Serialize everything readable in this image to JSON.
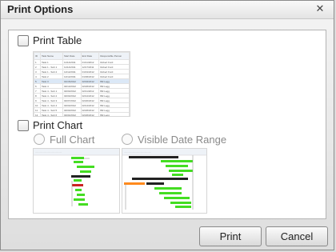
{
  "dialog": {
    "title": "Print Options",
    "close_icon": "close-icon (x)"
  },
  "print_table": {
    "label": "Print Table",
    "checked": false,
    "preview": {
      "columns": [
        "ID",
        "Task Name",
        "Start Date",
        "End Date",
        "Responsible Person"
      ],
      "rows": [
        [
          "1",
          "Task 1",
          "11/14/2011",
          "01/11/2012",
          "Robert Ford"
        ],
        [
          "2",
          "Task 1 - Sub 1",
          "11/14/2011",
          "12/17/2011",
          "Robert Ford"
        ],
        [
          "3",
          "Task 1 - Sub 2",
          "12/12/2011",
          "01/01/2012",
          "Robert Ford"
        ],
        [
          "4",
          "Task 2",
          "12/12/2011",
          "01/06/2012",
          "Robert Ford"
        ],
        [
          "5",
          "Task 3",
          "01/15/2012",
          "02/02/2012",
          "Bill Legg"
        ],
        [
          "6",
          "Task 4",
          "02/13/2012",
          "02/26/2012",
          "Bill Legg"
        ],
        [
          "7",
          "Task 4 - Sub 1",
          "02/03/2012",
          "02/11/2012",
          "Bill Legg"
        ],
        [
          "8",
          "Task 4 - Sub 2",
          "02/03/2012",
          "02/12/2012",
          "Bill Legg"
        ],
        [
          "9",
          "Task 4 - Sub 3",
          "02/07/2012",
          "02/20/2012",
          "Bill Legg"
        ],
        [
          "10",
          "Task 4 - Sub 4",
          "02/03/2012",
          "02/14/2012",
          "Bill Legg"
        ],
        [
          "11",
          "Task 4 - Sub 5",
          "02/03/2012",
          "02/26/2012",
          "Bill Legg"
        ],
        [
          "12",
          "Task 4 - Sub 6",
          "02/04/2012",
          "02/26/2012",
          "Bill Legg"
        ]
      ],
      "selected_row": 4
    }
  },
  "print_chart": {
    "label": "Print Chart",
    "checked": false,
    "options": {
      "full_chart": "Full Chart",
      "visible_date_range": "Visible Date Range"
    },
    "colors": {
      "bar_green": "#44dd22",
      "bar_orange": "#ff8a1c",
      "bar_black": "#222222",
      "bar_red": "#cc2222",
      "link": "#999999"
    }
  },
  "buttons": {
    "print": "Print",
    "cancel": "Cancel"
  }
}
